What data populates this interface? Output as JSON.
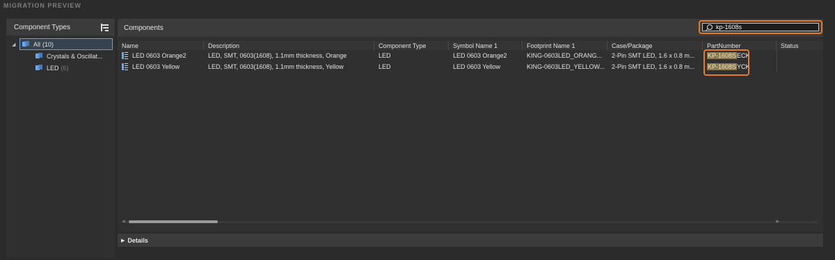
{
  "panel": {
    "title": "MIGRATION PREVIEW"
  },
  "left": {
    "header": "Component Types",
    "items": [
      {
        "label": "All",
        "count": "(10)"
      },
      {
        "label": "Crystals & Oscillat...",
        "count": ""
      },
      {
        "label": "LED",
        "count": "(6)"
      }
    ]
  },
  "main": {
    "header": "Components",
    "search": {
      "value": "kp-1608s"
    },
    "columns": [
      "Name",
      "Description",
      "Component Type",
      "Symbol Name 1",
      "Footprint Name 1",
      "Case/Package",
      "PartNumber",
      "Status"
    ],
    "rows": [
      {
        "name": "LED 0603 Orange2",
        "description": "LED, SMT, 0603(1608), 1.1mm thickness, Orange",
        "component_type": "LED",
        "symbol": "LED 0603 Orange2",
        "footprint": "KING-0603LED_ORANG...",
        "case": "2-Pin SMT LED, 1.6 x 0.8 m...",
        "part_match": "KP-1608S",
        "part_rest": "ECK",
        "status": ""
      },
      {
        "name": "LED 0603 Yellow",
        "description": "LED, SMT, 0603(1608), 1.1mm thickness, Yellow",
        "component_type": "LED",
        "symbol": "LED 0603 Yellow",
        "footprint": "KING-0603LED_YELLOW...",
        "case": "2-Pin SMT LED, 1.6 x 0.8 m...",
        "part_match": "KP-1608S",
        "part_rest": "YCK",
        "status": ""
      }
    ]
  },
  "details": {
    "label": "Details"
  },
  "colors": {
    "accent_orange": "#e87a22",
    "selection_border": "#7d98c4",
    "match_highlight": "#8a7a52"
  }
}
